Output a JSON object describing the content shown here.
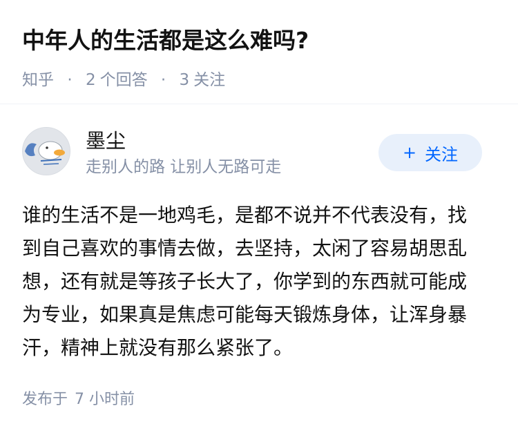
{
  "question": {
    "title": "中年人的生活都是这么难吗?",
    "source": "知乎",
    "separator": "·",
    "answer_count": "2",
    "answer_label": "个回答",
    "follower_count": "3",
    "follower_label": "关注"
  },
  "answer": {
    "author": {
      "name": "墨尘",
      "bio": "走别人的路 让别人无路可走",
      "avatar_icon": "avatar-duck-icon"
    },
    "follow_button": {
      "plus": "+",
      "label": "关注"
    },
    "content": "谁的生活不是一地鸡毛，是都不说并不代表没有，找到自己喜欢的事情去做，去坚持，太闲了容易胡思乱想，还有就是等孩子长大了，你学到的东西就可能成为专业，如果真是焦虑可能每天锻炼身体，让浑身暴汗，精神上就没有那么紧张了。",
    "published_label": "发布于",
    "published_time": "7 小时前"
  },
  "colors": {
    "text": "#121212",
    "muted": "#8590a6",
    "accent": "#0066ff",
    "button_bg": "#e8f0fb",
    "divider": "#f0f2f7"
  }
}
